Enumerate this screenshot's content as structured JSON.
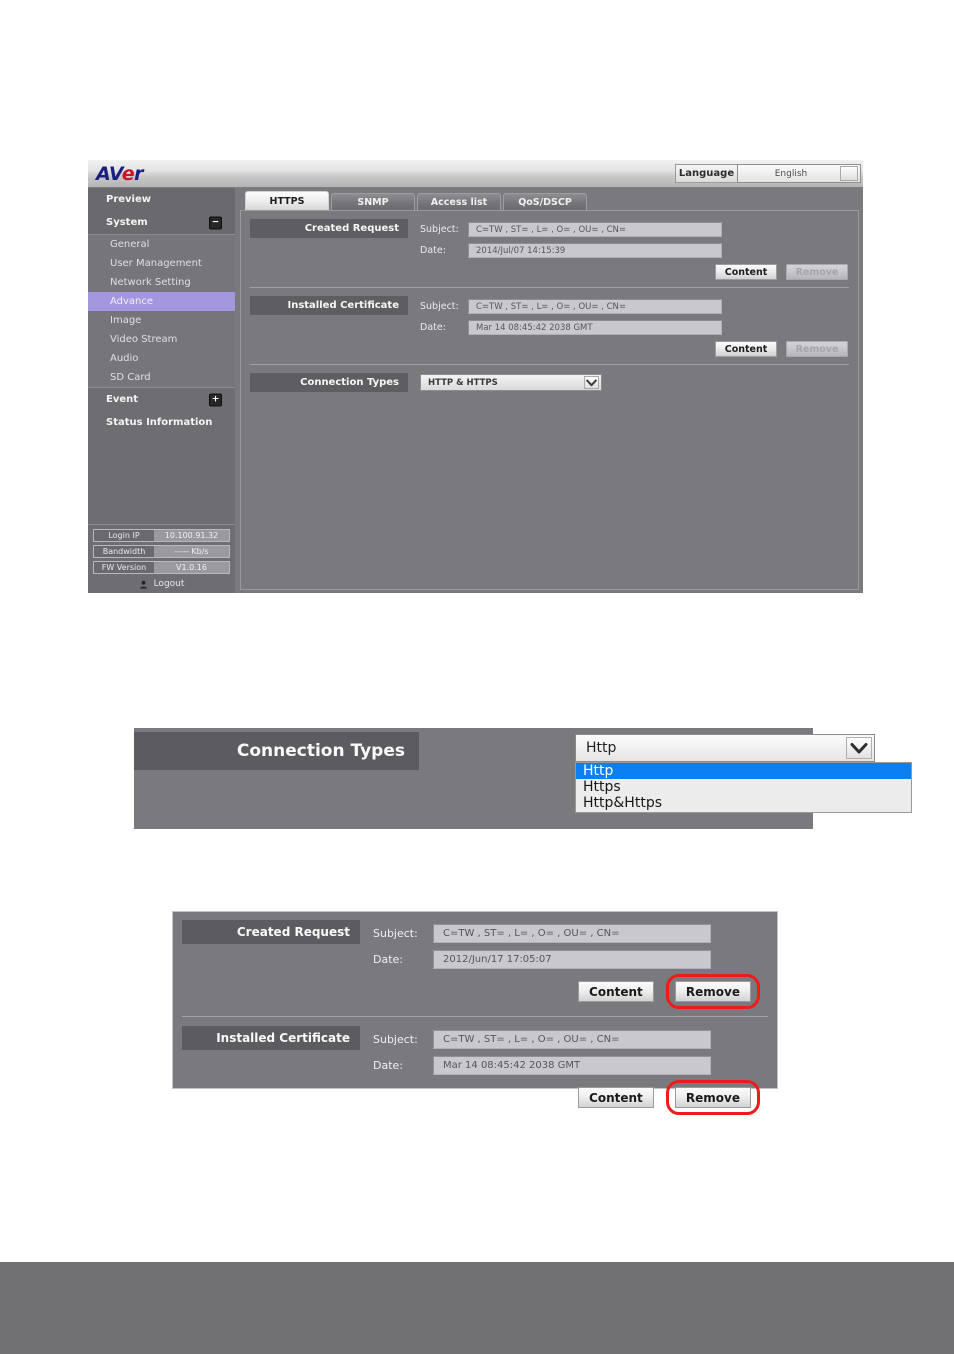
{
  "figure1": {
    "header": {
      "logo_text_av": "AV",
      "logo_text_e": "e",
      "logo_text_r": "r",
      "language_label": "Language",
      "language_value": "English"
    },
    "sidebar": {
      "preview": "Preview",
      "system": "System",
      "system_toggle": "−",
      "sub_items": [
        {
          "label": "General",
          "active": false
        },
        {
          "label": "User Management",
          "active": false
        },
        {
          "label": "Network Setting",
          "active": false
        },
        {
          "label": "Advance",
          "active": true
        },
        {
          "label": "Image",
          "active": false
        },
        {
          "label": "Video Stream",
          "active": false
        },
        {
          "label": "Audio",
          "active": false
        },
        {
          "label": "SD Card",
          "active": false
        }
      ],
      "event": "Event",
      "event_toggle": "+",
      "status_information": "Status Information",
      "status_rows": [
        {
          "key": "Login IP",
          "value": "10.100.91.32"
        },
        {
          "key": "Bandwidth",
          "value": "----- Kb/s"
        },
        {
          "key": "FW Version",
          "value": "V1.0.16"
        }
      ],
      "logout": "Logout"
    },
    "tabs": [
      {
        "label": "HTTPS",
        "active": true
      },
      {
        "label": "SNMP",
        "active": false
      },
      {
        "label": "Access list",
        "active": false
      },
      {
        "label": "QoS/DSCP",
        "active": false
      }
    ],
    "created_request": {
      "title": "Created Request",
      "subject_label": "Subject:",
      "subject_value": "C=TW , ST= , L= , O= , OU= , CN=",
      "date_label": "Date:",
      "date_value": "2014/Jul/07 14:15:39",
      "content_button": "Content",
      "remove_button": "Remove"
    },
    "installed_certificate": {
      "title": "Installed Certificate",
      "subject_label": "Subject:",
      "subject_value": "C=TW , ST= , L= , O= , OU= , CN=",
      "date_label": "Date:",
      "date_value": "Mar 14 08:45:42 2038 GMT",
      "content_button": "Content",
      "remove_button": "Remove"
    },
    "connection_types": {
      "title": "Connection Types",
      "selected": "HTTP & HTTPS"
    }
  },
  "figure2": {
    "label": "Connection Types",
    "selected": "Http",
    "options": [
      {
        "label": "Http",
        "selected": true
      },
      {
        "label": "Https",
        "selected": false
      },
      {
        "label": "Http&Https",
        "selected": false
      }
    ]
  },
  "figure3": {
    "created_request": {
      "title": "Created Request",
      "subject_label": "Subject:",
      "subject_value": "C=TW , ST= , L= , O= , OU= , CN=",
      "date_label": "Date:",
      "date_value": "2012/Jun/17 17:05:07",
      "content_button": "Content",
      "remove_button": "Remove"
    },
    "installed_certificate": {
      "title": "Installed Certificate",
      "subject_label": "Subject:",
      "subject_value": "C=TW , ST= , L= , O= , OU= , CN=",
      "date_label": "Date:",
      "date_value": "Mar 14 08:45:42 2038 GMT",
      "content_button": "Content",
      "remove_button": "Remove"
    }
  },
  "colors": {
    "panel_bg": "#7a7a7e",
    "label_bg": "#5c5c60",
    "sidebar_active": "#a596e0",
    "highlight_ring": "#ee1b19",
    "dropdown_selected": "#0a7ff0",
    "logo_blue": "#1b2080",
    "logo_red": "#cf1020",
    "footer_band": "#717173"
  }
}
